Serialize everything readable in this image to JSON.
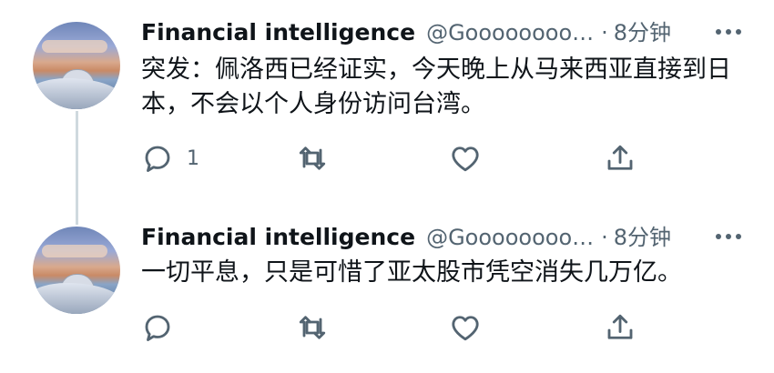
{
  "tweets": [
    {
      "display_name": "Financial intelligence",
      "handle": "@Goooooooo…",
      "separator": "·",
      "time": "8分钟",
      "text": "突发：佩洛西已经证实，今天晚上从马来西亚直接到日本，不会以个人身份访问台湾。",
      "reply_count": "1"
    },
    {
      "display_name": "Financial intelligence",
      "handle": "@Goooooooo…",
      "separator": "·",
      "time": "8分钟",
      "text": "一切平息，只是可惜了亚太股市凭空消失几万亿。",
      "reply_count": ""
    }
  ],
  "colors": {
    "text": "#0f1419",
    "secondary": "#536471",
    "thread_line": "#cfd9de"
  },
  "icons": [
    "reply-icon",
    "retweet-icon",
    "like-icon",
    "share-icon",
    "more-icon"
  ]
}
